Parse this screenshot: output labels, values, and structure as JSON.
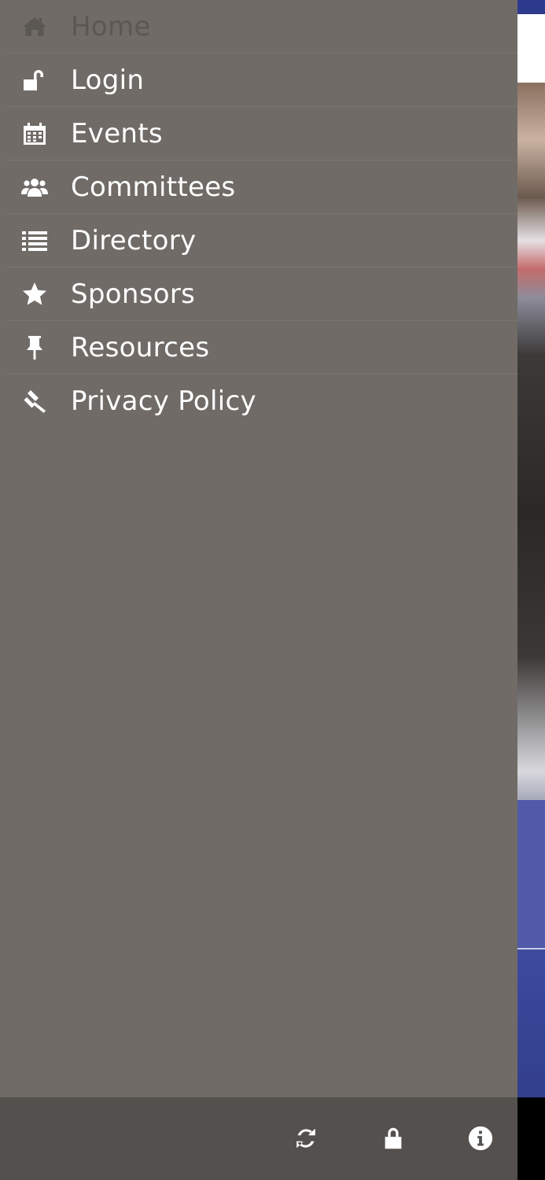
{
  "menu": {
    "items": [
      {
        "label": "Home",
        "icon": "home-icon",
        "active": true
      },
      {
        "label": "Login",
        "icon": "unlock-icon"
      },
      {
        "label": "Events",
        "icon": "calendar-icon"
      },
      {
        "label": "Committees",
        "icon": "users-icon"
      },
      {
        "label": "Directory",
        "icon": "list-icon"
      },
      {
        "label": "Sponsors",
        "icon": "star-icon"
      },
      {
        "label": "Resources",
        "icon": "pushpin-icon"
      },
      {
        "label": "Privacy Policy",
        "icon": "gavel-icon"
      }
    ]
  },
  "toolbar": {
    "buttons": [
      {
        "icon": "refresh-icon"
      },
      {
        "icon": "lock-icon"
      },
      {
        "icon": "info-icon"
      }
    ]
  },
  "colors": {
    "drawer_bg": "#706b66",
    "toolbar_bg": "#53504d",
    "active_text": "#5b5753",
    "text": "#ffffff",
    "underlying_blue": "#505aa8"
  }
}
